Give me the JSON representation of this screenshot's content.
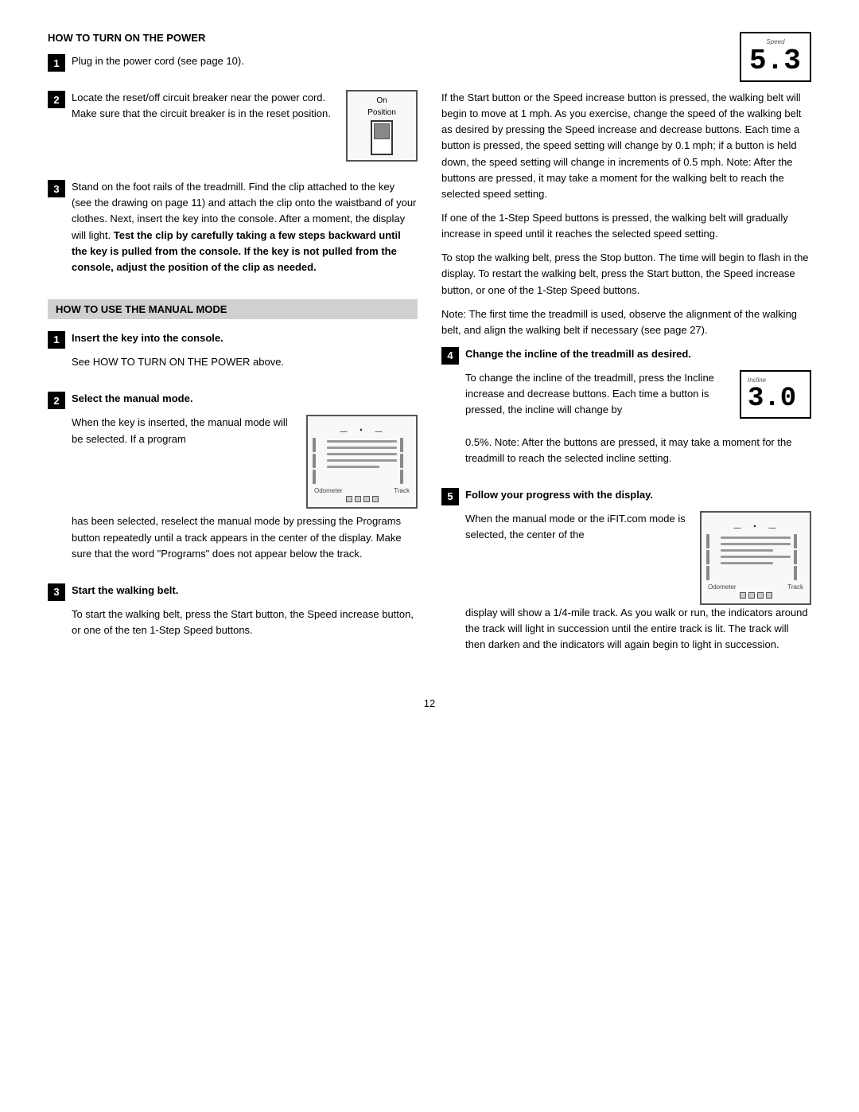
{
  "page": {
    "number": "12"
  },
  "left": {
    "section1": {
      "heading": "HOW TO TURN ON THE POWER",
      "step1": {
        "number": "1",
        "text": "Plug in the power cord (see page 10)."
      },
      "step2": {
        "number": "2",
        "text_parts": [
          "Locate the reset/off circuit breaker near the power cord. Make sure that the circuit breaker is in the reset position."
        ],
        "switch_label": "On",
        "switch_sublabel": "Position"
      },
      "step3": {
        "number": "3",
        "text_normal": "Stand on the foot rails of the treadmill. Find the clip attached to the key (see the drawing on page 11) and attach the clip onto the waistband of your clothes. Next, insert the key into the console. After a moment, the display will light. ",
        "text_bold": "Test the clip by carefully taking a few steps backward until the key is pulled from the console. If the key is not pulled from the console, adjust the position of the clip as needed."
      }
    },
    "section2": {
      "heading": "HOW TO USE THE MANUAL MODE",
      "step1": {
        "number": "1",
        "title": "Insert the key into the console.",
        "text": "See HOW TO TURN ON THE POWER above."
      },
      "step2": {
        "number": "2",
        "title": "Select the manual mode.",
        "text_before": "When the key is inserted, the manual mode will be selected. If a program",
        "text_after": "has been selected, reselect the manual mode by pressing the Programs button repeatedly until a track appears in the center of the display. Make sure that the word \"Programs\" does not appear below the track.",
        "console_labels": {
          "odometer": "Odometer",
          "track": "Track"
        }
      },
      "step3": {
        "number": "3",
        "title": "Start the walking belt.",
        "text": "To start the walking belt, press the Start button, the Speed increase button, or one of the ten 1-Step Speed buttons."
      }
    }
  },
  "right": {
    "speed_display": {
      "label": "Speed",
      "value": "5.3"
    },
    "para1": "If the Start button or the Speed increase button is pressed, the walking belt will begin to move at 1 mph. As you exercise, change the speed of the walking belt as desired by pressing the Speed increase and decrease buttons. Each time a button is pressed, the speed setting will change by 0.1 mph; if a button is held down, the speed setting will change in increments of 0.5 mph. Note: After the buttons are pressed, it may take a moment for the walking belt to reach the selected speed setting.",
    "para2": "If one of the 1-Step Speed buttons is pressed, the walking belt will gradually increase in speed until it reaches the selected speed setting.",
    "para3": "To stop the walking belt, press the Stop button. The time will begin to flash in the display. To restart the walking belt, press the Start button, the Speed increase button, or one of the 1-Step Speed buttons.",
    "para4": "Note: The first time the treadmill is used, observe the alignment of the walking belt, and align the walking belt if necessary (see page 27).",
    "step4": {
      "number": "4",
      "title": "Change the incline of the treadmill as desired.",
      "text_before": "To change the incline of the treadmill, press the Incline increase and decrease buttons. Each time a button is pressed, the incline will change by",
      "text_after": "0.5%. Note: After the buttons are pressed, it may take a moment for the treadmill to reach the selected incline setting.",
      "incline_display": {
        "label": "Incline",
        "value": "3.0"
      }
    },
    "step5": {
      "number": "5",
      "title": "Follow your progress with the display.",
      "text_before": "When the manual mode or the iFIT.com mode is selected, the center of the",
      "text_after": "display will show a 1/4-mile track. As you walk or run, the indicators around the track will light in succession until the entire track is lit. The track will then darken and the indicators will again begin to light in succession.",
      "console_labels": {
        "odometer": "Odometer",
        "track": "Track"
      }
    }
  }
}
